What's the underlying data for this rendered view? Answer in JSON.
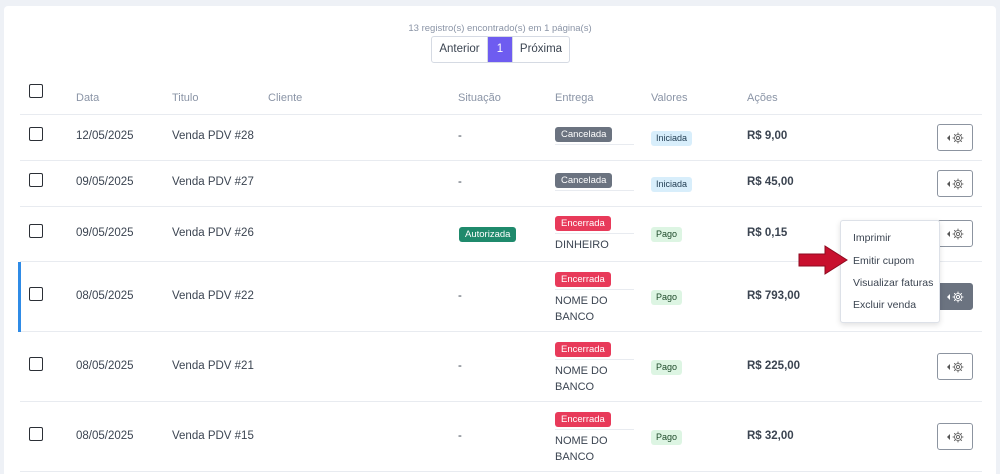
{
  "pagination": {
    "records_info": "13 registro(s) encontrado(s) em 1 página(s)",
    "prev_label": "Anterior",
    "current_page": "1",
    "next_label": "Próxima"
  },
  "table": {
    "columns": [
      "Data",
      "Titulo",
      "Cliente",
      "Situação",
      "Entrega",
      "Valores",
      "Ações"
    ],
    "rows": [
      {
        "date": "12/05/2025",
        "title": "Venda PDV #28",
        "client": "",
        "situacao": "-",
        "entrega_badge": "Cancelada",
        "entrega_text": "",
        "valores_badge": "Iniciada",
        "amount": "R$ 9,00"
      },
      {
        "date": "09/05/2025",
        "title": "Venda PDV #27",
        "client": "",
        "situacao": "-",
        "entrega_badge": "Cancelada",
        "entrega_text": "",
        "valores_badge": "Iniciada",
        "amount": "R$ 45,00"
      },
      {
        "date": "09/05/2025",
        "title": "Venda PDV #26",
        "client": "",
        "situacao": "Autorizada",
        "entrega_badge": "Encerrada",
        "entrega_text": "DINHEIRO",
        "valores_badge": "Pago",
        "amount": "R$ 0,15"
      },
      {
        "date": "08/05/2025",
        "title": "Venda PDV #22",
        "client": "",
        "situacao": "-",
        "entrega_badge": "Encerrada",
        "entrega_text": "NOME DO BANCO",
        "valores_badge": "Pago",
        "amount": "R$ 793,00"
      },
      {
        "date": "08/05/2025",
        "title": "Venda PDV #21",
        "client": "",
        "situacao": "-",
        "entrega_badge": "Encerrada",
        "entrega_text": "NOME DO BANCO",
        "valores_badge": "Pago",
        "amount": "R$ 225,00"
      },
      {
        "date": "08/05/2025",
        "title": "Venda PDV #15",
        "client": "",
        "situacao": "-",
        "entrega_badge": "Encerrada",
        "entrega_text": "NOME DO BANCO",
        "valores_badge": "Pago",
        "amount": "R$ 32,00"
      }
    ]
  },
  "actions_menu": {
    "items": [
      "Imprimir",
      "Emitir cupom",
      "Visualizar faturas",
      "Excluir venda"
    ],
    "highlighted_item": "Emitir cupom"
  },
  "colors": {
    "accent": "#6e5cf0",
    "row_selected_bar": "#2f8be6",
    "arrow": "#c8102e"
  }
}
